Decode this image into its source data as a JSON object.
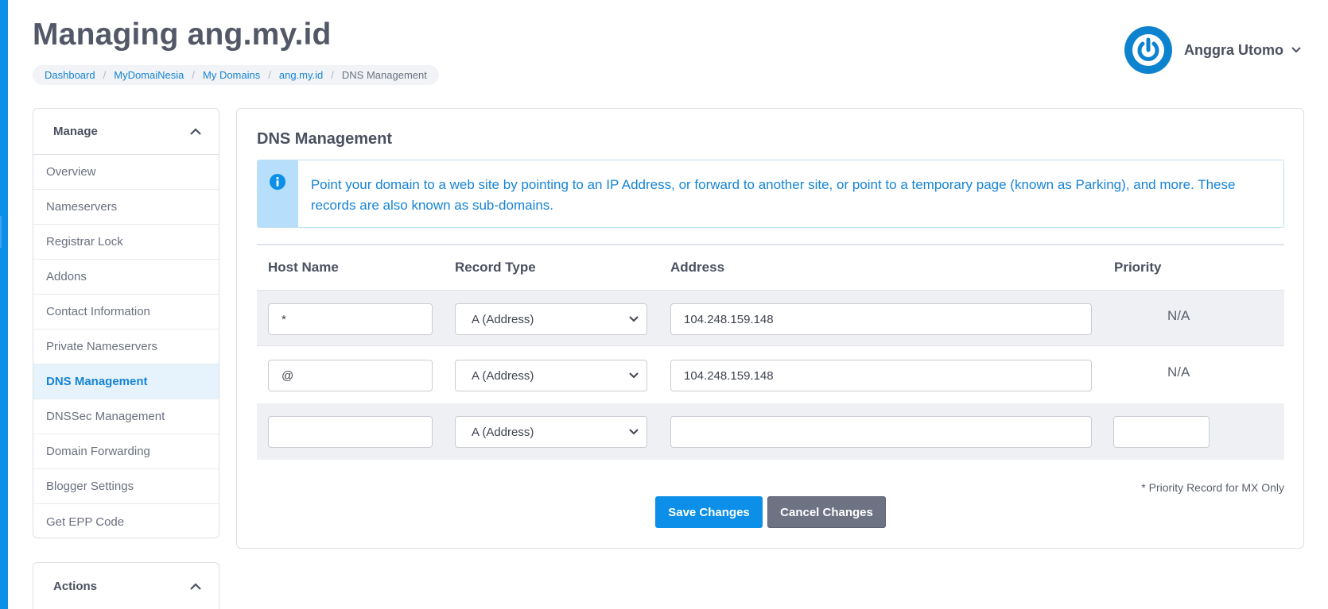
{
  "page": {
    "title": "Managing ang.my.id"
  },
  "breadcrumb": [
    {
      "label": "Dashboard"
    },
    {
      "label": "MyDomaiNesia"
    },
    {
      "label": "My Domains"
    },
    {
      "label": "ang.my.id"
    },
    {
      "label": "DNS Management"
    }
  ],
  "user": {
    "name": "Anggra Utomo"
  },
  "sidebar": {
    "manage_title": "Manage",
    "items": [
      {
        "label": "Overview"
      },
      {
        "label": "Nameservers"
      },
      {
        "label": "Registrar Lock"
      },
      {
        "label": "Addons"
      },
      {
        "label": "Contact Information"
      },
      {
        "label": "Private Nameservers"
      },
      {
        "label": "DNS Management"
      },
      {
        "label": "DNSSec Management"
      },
      {
        "label": "Domain Forwarding"
      },
      {
        "label": "Blogger Settings"
      },
      {
        "label": "Get EPP Code"
      }
    ],
    "active_index": 6,
    "actions_title": "Actions"
  },
  "main": {
    "title": "DNS Management",
    "info_text": "Point your domain to a web site by pointing to an IP Address, or forward to another site, or point to a temporary page (known as Parking), and more. These records are also known as sub-domains.",
    "columns": [
      "Host Name",
      "Record Type",
      "Address",
      "Priority"
    ],
    "rows": [
      {
        "host": "*",
        "type": "A (Address)",
        "address": "104.248.159.148",
        "priority": "N/A"
      },
      {
        "host": "@",
        "type": "A (Address)",
        "address": "104.248.159.148",
        "priority": "N/A"
      },
      {
        "host": "",
        "type": "A (Address)",
        "address": "",
        "priority": ""
      }
    ],
    "note": "* Priority Record for MX Only",
    "save_label": "Save Changes",
    "cancel_label": "Cancel Changes"
  },
  "colors": {
    "accent": "#0b8fe8",
    "link": "#1784d6",
    "cancel": "#6e7384"
  }
}
